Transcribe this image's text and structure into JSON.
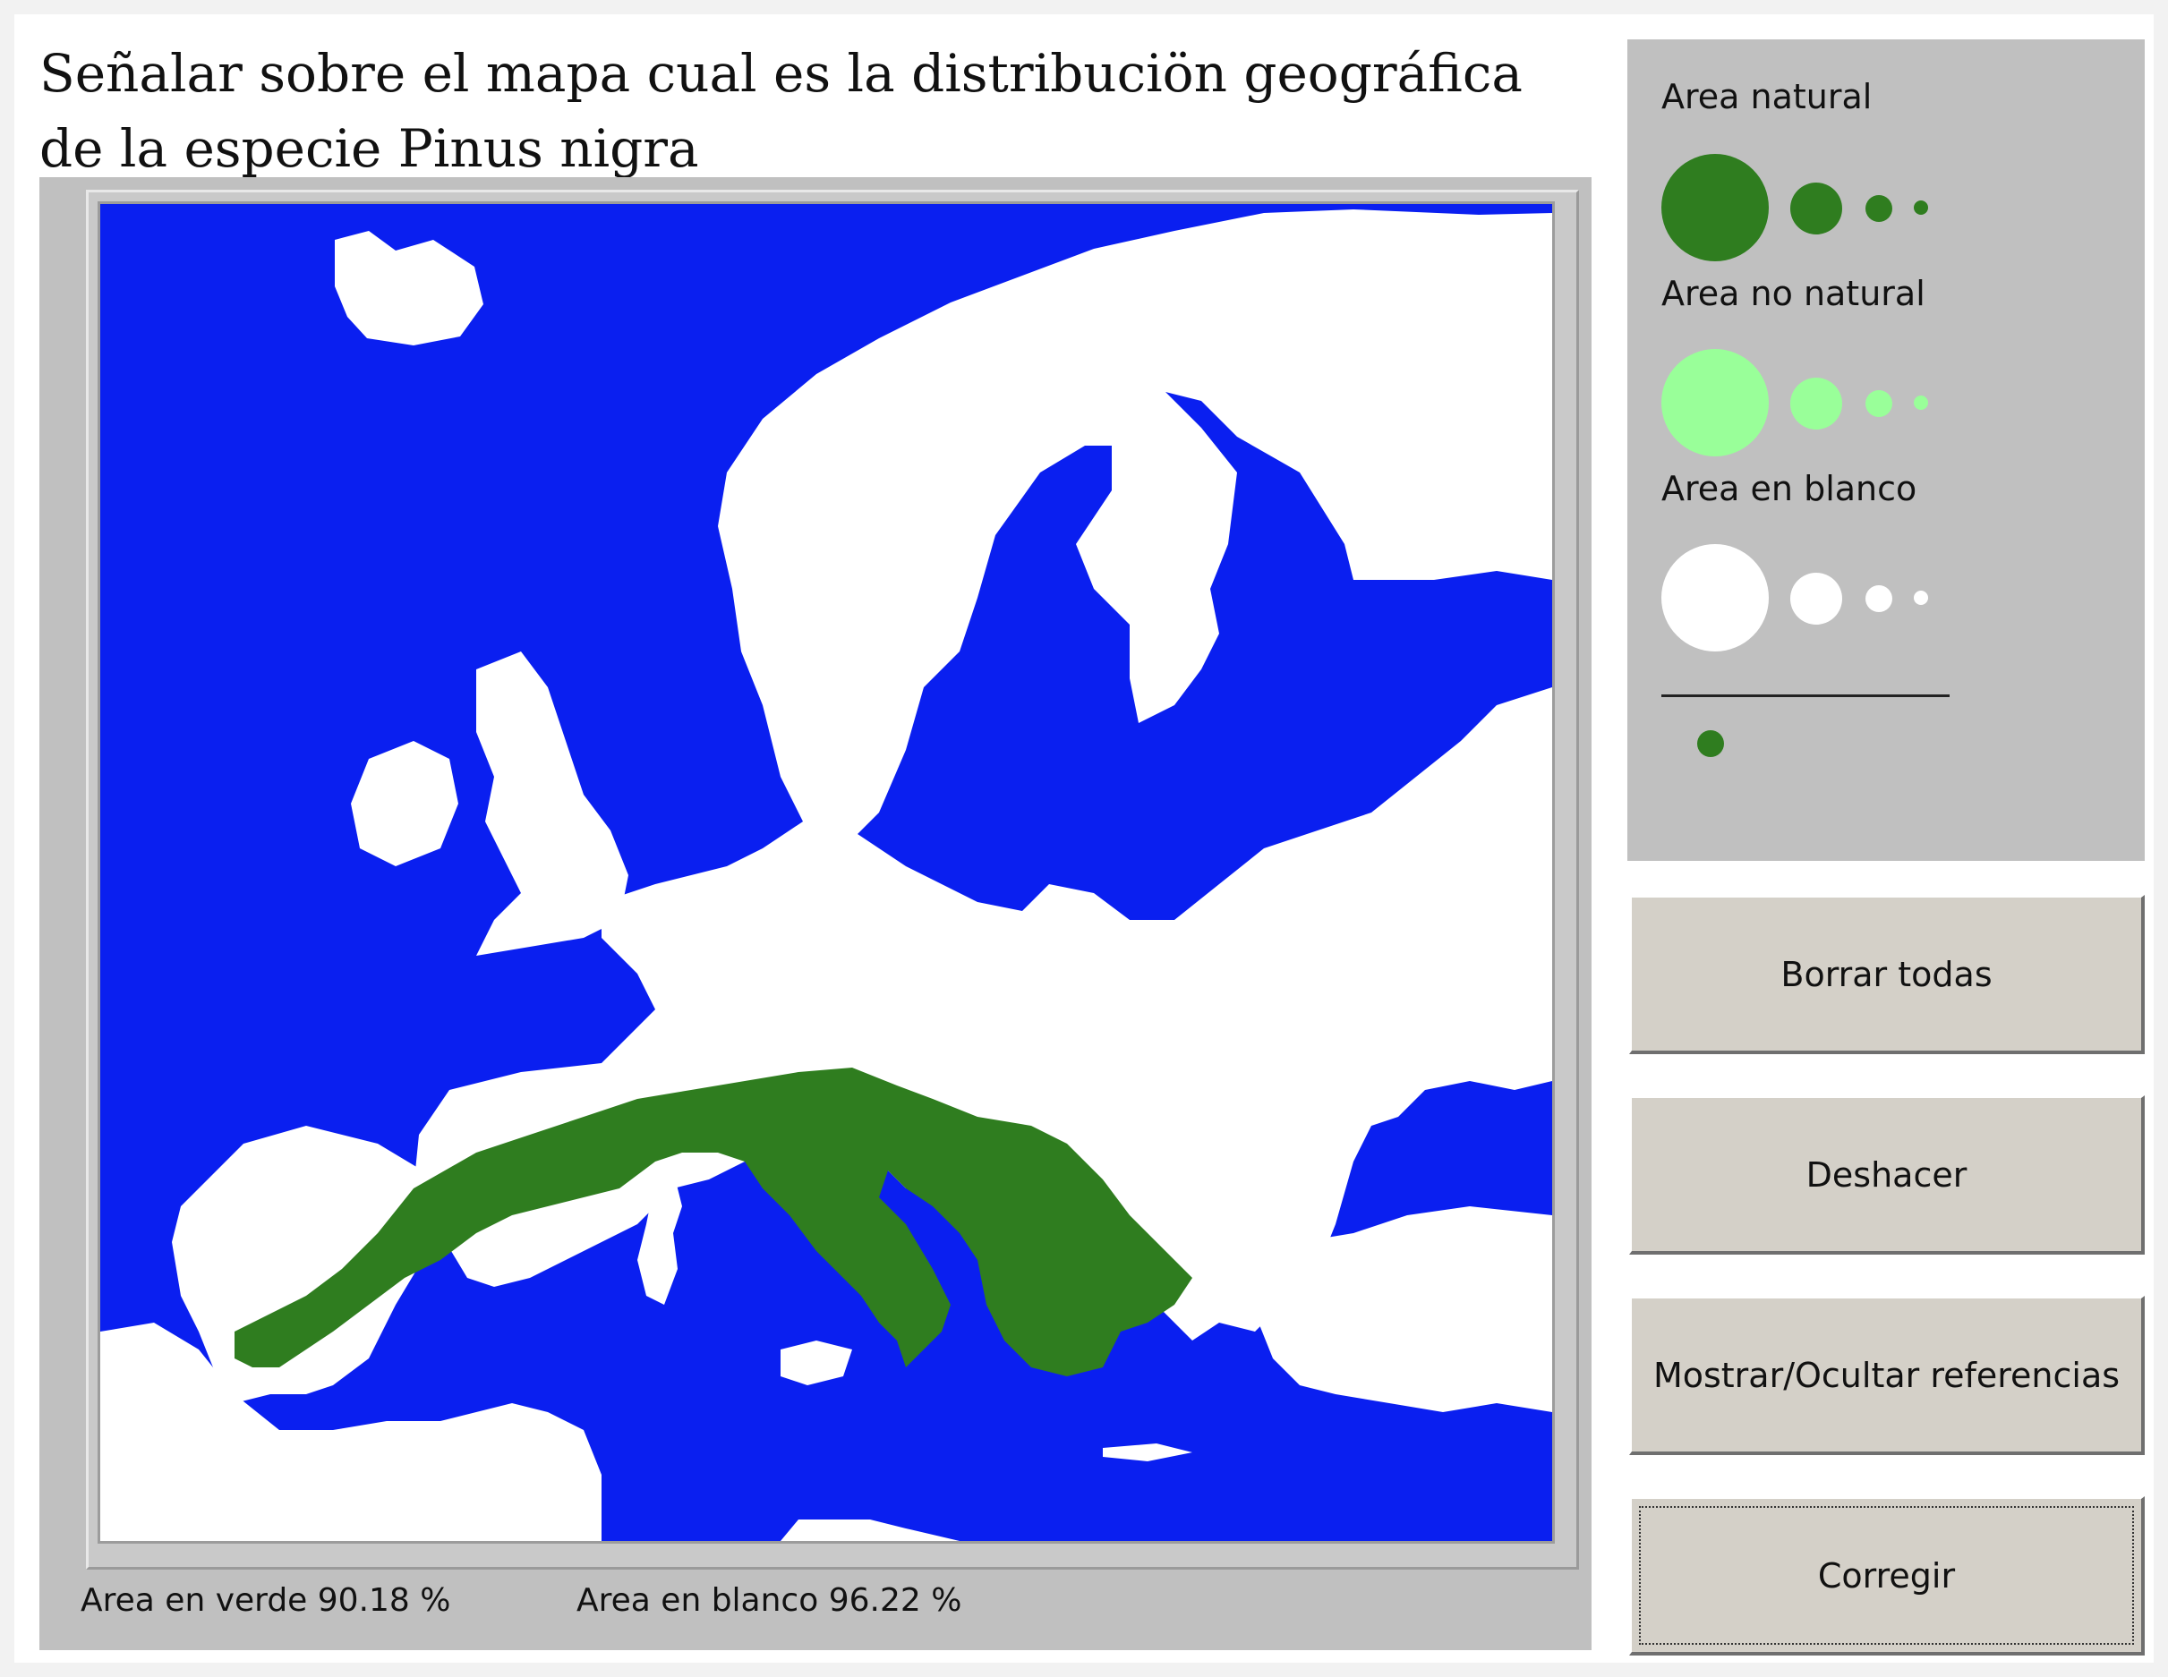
{
  "title": {
    "line1": "Señalar sobre el mapa cual es la distribuciön geográfica",
    "line2": "de la especie Pinus nigra"
  },
  "map": {
    "region": "Europe",
    "colors": {
      "sea": "#0a1ff0",
      "land": "#ffffff",
      "area_natural": "#2f7d1f",
      "area_no_natural": "#99ff99",
      "area_blanco": "#ffffff"
    }
  },
  "stats": {
    "verde": "Area en verde 90.18 %",
    "blanco": "Area en blanco 96.22 %"
  },
  "legend": {
    "natural_label": "Area natural",
    "no_natural_label": "Area no natural",
    "blanco_label": "Area en blanco"
  },
  "buttons": {
    "borrar": "Borrar todas",
    "deshacer": "Deshacer",
    "mostrar": "Mostrar/Ocultar referencias",
    "corregir": "Corregir"
  }
}
